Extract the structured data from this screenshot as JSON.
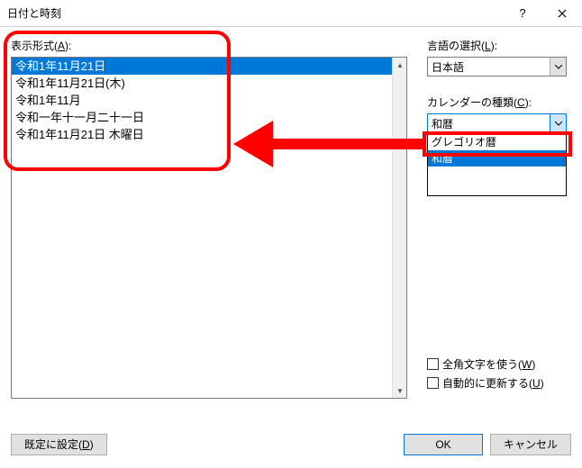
{
  "titlebar": {
    "title": "日付と時刻"
  },
  "format": {
    "label": "表示形式",
    "accel": "(A)",
    "items": [
      "令和1年11月21日",
      "令和1年11月21日(木)",
      "令和1年11月",
      "令和一年十一月二十一日",
      "令和1年11月21日 木曜日"
    ]
  },
  "language": {
    "label": "言語の選択",
    "accel": "(L)",
    "value": "日本語"
  },
  "calendar": {
    "label": "カレンダーの種類",
    "accel": "(C)",
    "value": "和暦",
    "options": [
      "グレゴリオ暦",
      "和暦"
    ]
  },
  "checkboxes": {
    "fullwidth": {
      "label": "全角文字を使う",
      "accel": "(W)"
    },
    "autoupdate": {
      "label": "自動的に更新する",
      "accel": "(U)"
    }
  },
  "buttons": {
    "setdefault": {
      "label": "既定に設定",
      "accel": "(D)"
    },
    "ok": "OK",
    "cancel": "キャンセル"
  }
}
